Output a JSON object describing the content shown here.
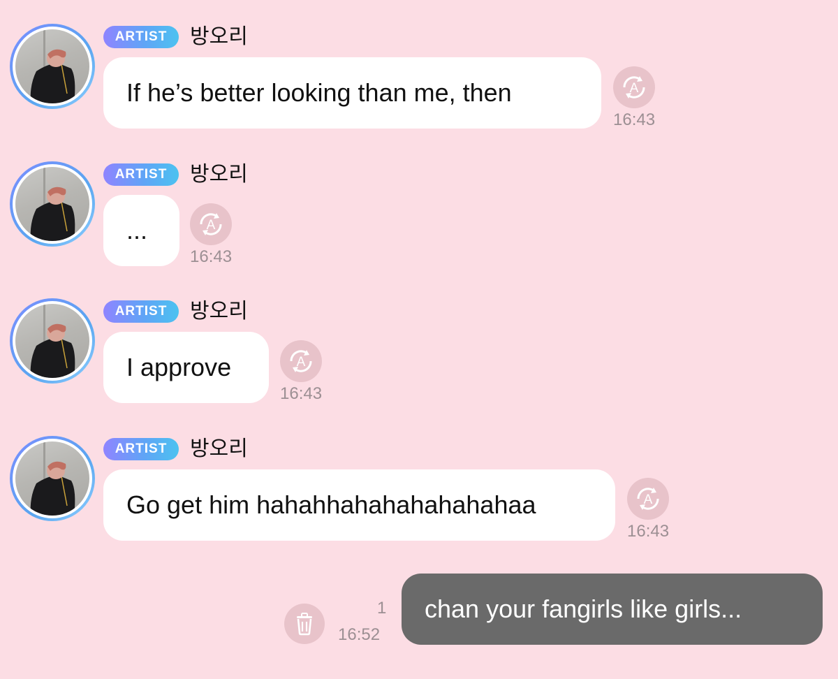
{
  "messages": [
    {
      "badge": "ARTIST",
      "sender": "방오리",
      "text": "If he’s better looking than me, then",
      "time": "16:43",
      "translate_icon": "translate-icon"
    },
    {
      "badge": "ARTIST",
      "sender": "방오리",
      "text": "...",
      "time": "16:43",
      "translate_icon": "translate-icon"
    },
    {
      "badge": "ARTIST",
      "sender": "방오리",
      "text": "I approve",
      "time": "16:43",
      "translate_icon": "translate-icon"
    },
    {
      "badge": "ARTIST",
      "sender": "방오리",
      "text": "Go get him hahahhahahahahahahaa",
      "time": "16:43",
      "translate_icon": "translate-icon"
    }
  ],
  "outgoing": {
    "text": "chan your fangirls like girls...",
    "unread_count": "1",
    "time": "16:52",
    "delete_icon": "trash-icon"
  },
  "colors": {
    "background": "#fcdde4",
    "incoming_bubble": "#ffffff",
    "outgoing_bubble": "#6a6a6a",
    "badge_gradient_start": "#8f84ff",
    "badge_gradient_end": "#4cc2f0",
    "timestamp": "#9c8f93",
    "icon_circle": "#e8c3ca"
  }
}
